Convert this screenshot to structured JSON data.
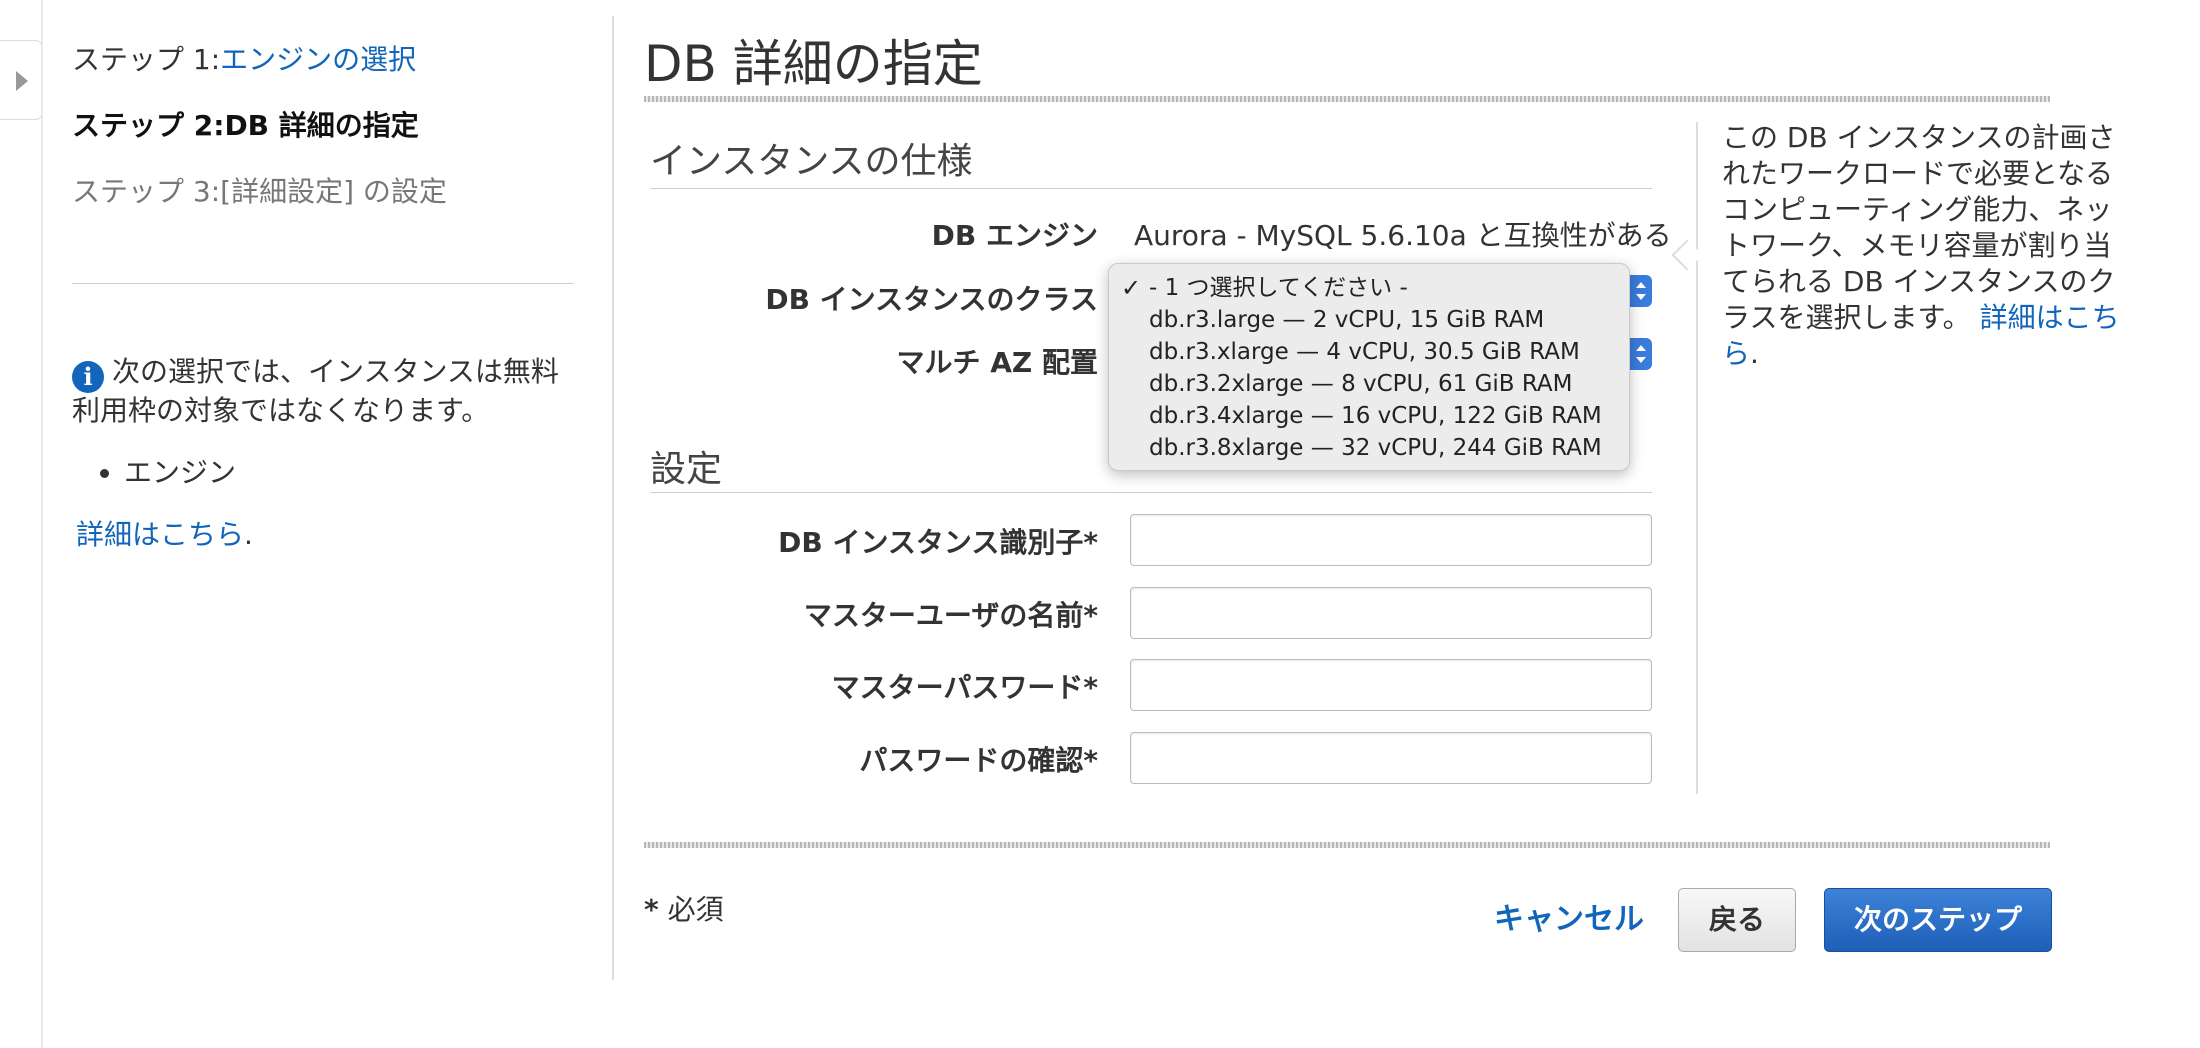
{
  "sidebar": {
    "steps": [
      {
        "prefix": "ステップ 1:",
        "label": "エンジンの選択"
      },
      {
        "prefix": "ステップ 2:",
        "label": "DB 詳細の指定"
      },
      {
        "prefix": "ステップ 3:",
        "label": "[詳細設定] の設定"
      }
    ],
    "info": {
      "icon": "info-icon",
      "text": "次の選択では、インスタンスは無料利用枠の対象ではなくなります。",
      "items": [
        "エンジン"
      ],
      "more_link": "詳細はこちら",
      "more_suffix": "."
    }
  },
  "page": {
    "title": "DB 詳細の指定"
  },
  "spec": {
    "title": "インスタンスの仕様",
    "engine_label": "DB エンジン",
    "engine_value": "Aurora - MySQL 5.6.10a と互換性がある",
    "class_label": "DB インスタンスのクラス",
    "multiaz_label": "マルチ AZ 配置",
    "class_options": [
      "- 1 つ選択してください -",
      "db.r3.large — 2 vCPU, 15 GiB RAM",
      "db.r3.xlarge — 4 vCPU, 30.5 GiB RAM",
      "db.r3.2xlarge — 8 vCPU, 61 GiB RAM",
      "db.r3.4xlarge — 16 vCPU, 122 GiB RAM",
      "db.r3.8xlarge — 32 vCPU, 244 GiB RAM"
    ],
    "selected_mark": "✓"
  },
  "settings": {
    "title": "設定",
    "fields": [
      {
        "label": "DB インスタンス識別子*",
        "value": ""
      },
      {
        "label": "マスターユーザの名前*",
        "value": ""
      },
      {
        "label": "マスターパスワード*",
        "value": ""
      },
      {
        "label": "パスワードの確認*",
        "value": ""
      }
    ]
  },
  "help": {
    "text": "この DB インスタンスの計画されたワークロードで必要となるコンピューティング能力、ネットワーク、メモリ容量が割り当てられる DB インスタンスのクラスを選択します。",
    "link": "詳細はこちら",
    "suffix": "."
  },
  "footer": {
    "required_star": "*",
    "required_label": "必須",
    "cancel": "キャンセル",
    "back": "戻る",
    "next": "次のステップ"
  },
  "colors": {
    "link": "#1166bb",
    "primary": "#1e5fb8"
  }
}
